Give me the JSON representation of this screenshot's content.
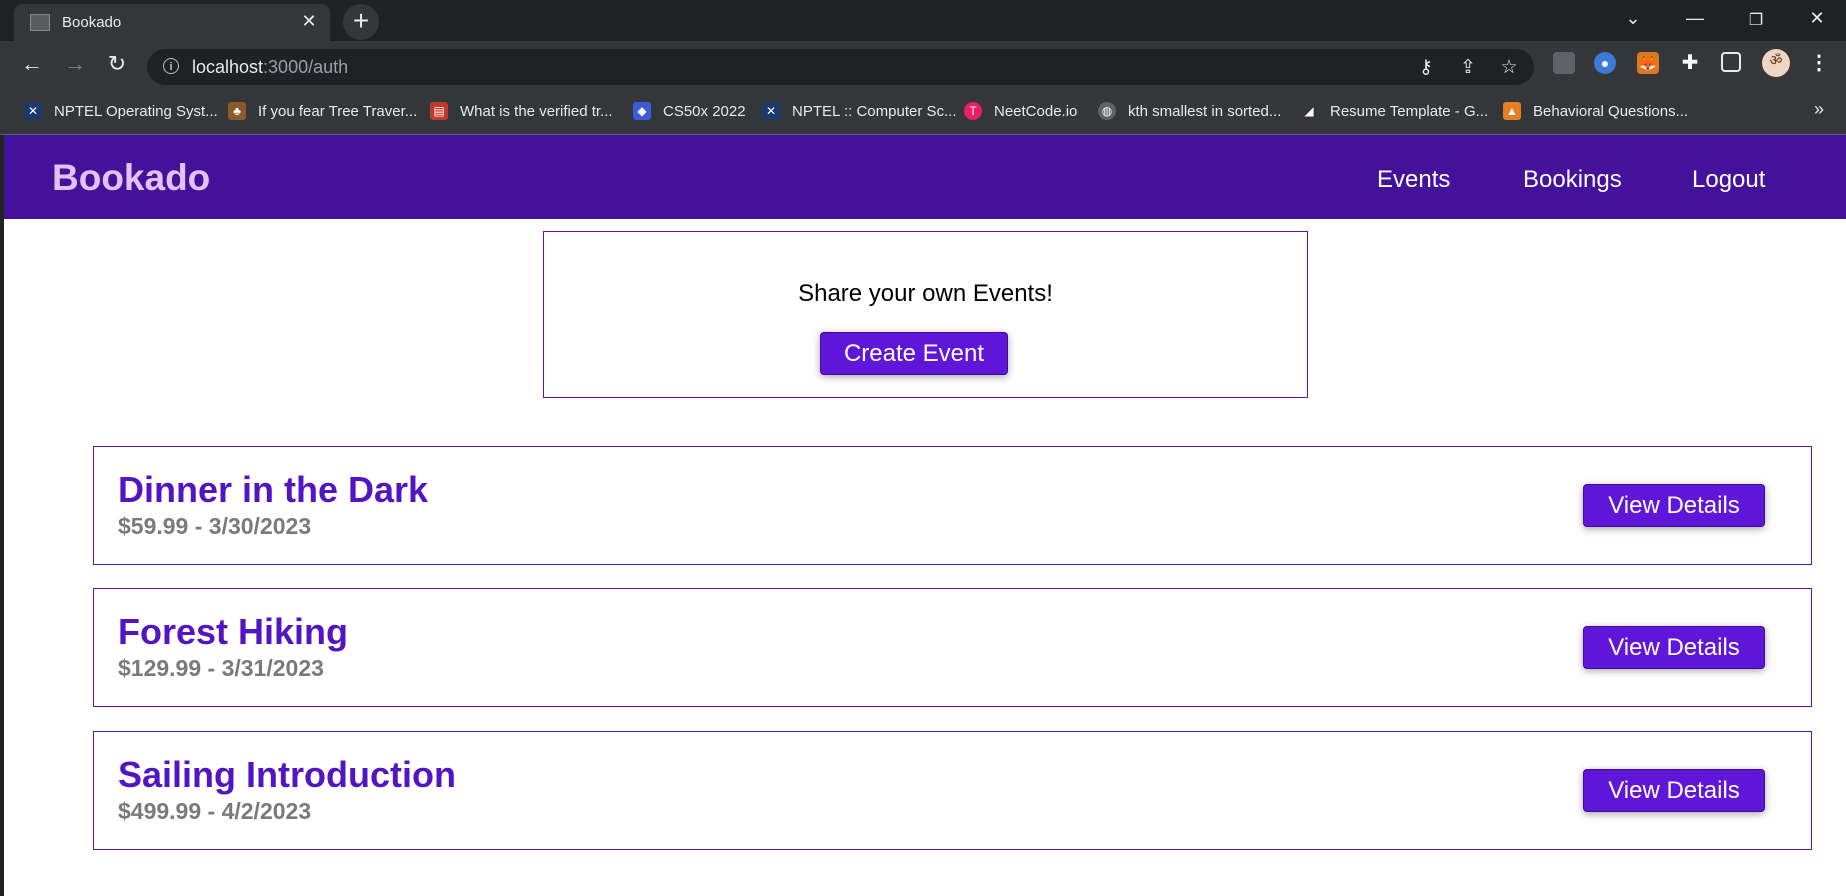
{
  "browser": {
    "tab_title": "Bookado",
    "url_host": "localhost",
    "url_rest": ":3000/auth",
    "bookmarks": [
      {
        "label": "NPTEL Operating Syst...",
        "icon": "nptel-icon",
        "color": "#1a3a6b"
      },
      {
        "label": "If you fear Tree Traver...",
        "icon": "tree-icon",
        "color": "#8a5a2b"
      },
      {
        "label": "What is the verified tr...",
        "icon": "briefcase-icon",
        "color": "#c0392b"
      },
      {
        "label": "CS50x 2022",
        "icon": "cs50-icon",
        "color": "#3b5bdb"
      },
      {
        "label": "NPTEL :: Computer Sc...",
        "icon": "nptel-icon",
        "color": "#1a3a6b"
      },
      {
        "label": "NeetCode.io",
        "icon": "neetcode-icon",
        "color": "#e91e63"
      },
      {
        "label": "kth smallest in sorted...",
        "icon": "globe-icon",
        "color": "#5f6368"
      },
      {
        "label": "Resume Template - G...",
        "icon": "resume-icon",
        "color": "#ffffff"
      },
      {
        "label": "Behavioral Questions...",
        "icon": "behavioral-icon",
        "color": "#e67e22"
      }
    ],
    "more_bookmarks": "»"
  },
  "app": {
    "brand": "Bookado",
    "nav": {
      "events": "Events",
      "bookings": "Bookings",
      "logout": "Logout"
    },
    "share": {
      "text": "Share your own Events!",
      "button": "Create Event"
    },
    "events": [
      {
        "title": "Dinner in the Dark",
        "meta": "$59.99 - 3/30/2023",
        "button": "View Details"
      },
      {
        "title": "Forest Hiking",
        "meta": "$129.99 - 3/31/2023",
        "button": "View Details"
      },
      {
        "title": "Sailing Introduction",
        "meta": "$499.99 - 4/2/2023",
        "button": "View Details"
      }
    ]
  },
  "colors": {
    "navbar": "#43119a",
    "brand": "#e1c3f7",
    "accent": "#5314c4",
    "button": "#6016d8",
    "meta_text": "#7a7a7a"
  }
}
